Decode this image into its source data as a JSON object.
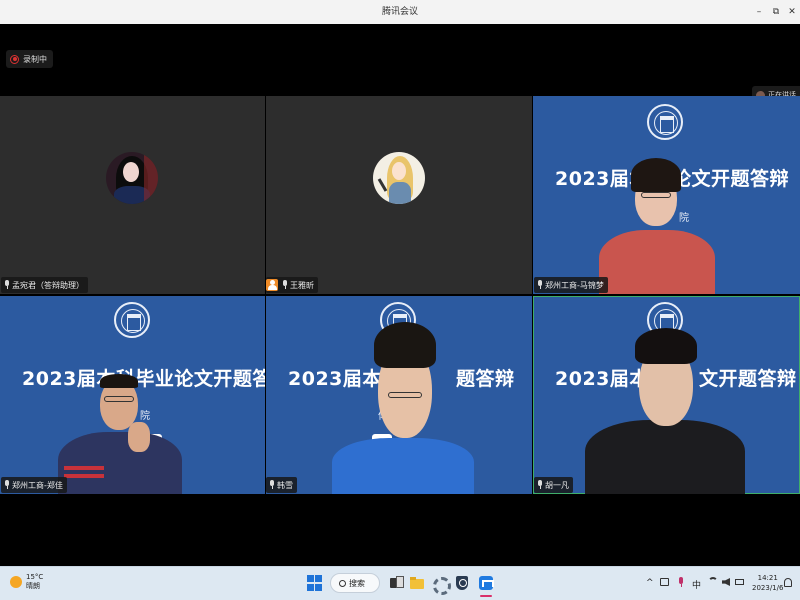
{
  "window": {
    "title": "腾讯会议",
    "controls": {
      "minimize": "–",
      "restore": "⧉",
      "close": "✕"
    }
  },
  "recording": {
    "label": "录制中"
  },
  "speaking": {
    "label": "正在讲话"
  },
  "slide": {
    "title": "2023届本科毕业论文开题答辩"
  },
  "participants": [
    {
      "name": "孟宛君（答辩助理）",
      "video": false
    },
    {
      "name": "王雅昕",
      "video": false
    },
    {
      "name": "郑州工商-马锦梦",
      "video": true
    },
    {
      "name": "郑州工商-郑佳",
      "video": true
    },
    {
      "name": "韩雪",
      "video": true
    },
    {
      "name": "胡一凡",
      "video": true,
      "active": true
    }
  ],
  "tile_texts": {
    "t3_title": "2023届本科",
    "t3_title_tail": "论文开题答辩",
    "t3_sub": "院",
    "t4_title": "2023届本科毕业论文开题答辩",
    "t4_sub": "院",
    "t5_title": "2023届本科",
    "t5_title_tail": "题答辩",
    "t5_sub": "体",
    "t6_title": "2023届本科",
    "t6_title_tail": "文开题答辩"
  },
  "taskbar": {
    "weather": {
      "temp": "15°C",
      "condition": "晴朗",
      "icon": "sun-icon"
    },
    "search_label": "搜索",
    "tray": {
      "chevron": "^",
      "ime": "中",
      "time": "14:21",
      "date": "2023/1/6"
    }
  },
  "colors": {
    "slide_blue": "#2c5aa0",
    "active_border": "#3fae6a",
    "taskbar": "#dde8f2",
    "badge_orange": "#f08c28"
  }
}
